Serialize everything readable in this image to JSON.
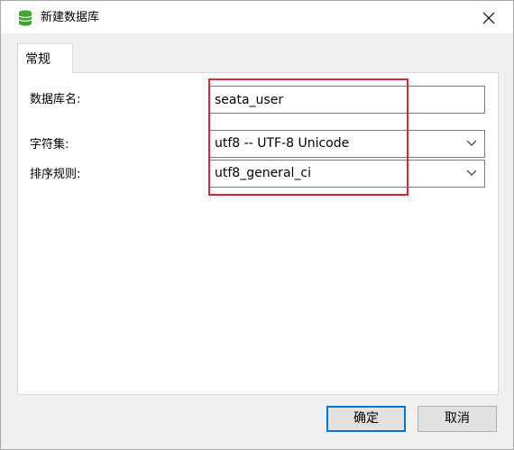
{
  "window": {
    "title": "新建数据库",
    "icon": "database-icon",
    "accent_color": "#3fa535"
  },
  "tabs": [
    {
      "label": "常规",
      "active": true
    }
  ],
  "form": {
    "db_name_label": "数据库名:",
    "db_name_value": "seata_user",
    "charset_label": "字符集:",
    "charset_value": "utf8 -- UTF-8 Unicode",
    "collation_label": "排序规则:",
    "collation_value": "utf8_general_ci"
  },
  "highlight_color": "#e0262b",
  "buttons": {
    "ok_label": "确定",
    "cancel_label": "取消"
  }
}
